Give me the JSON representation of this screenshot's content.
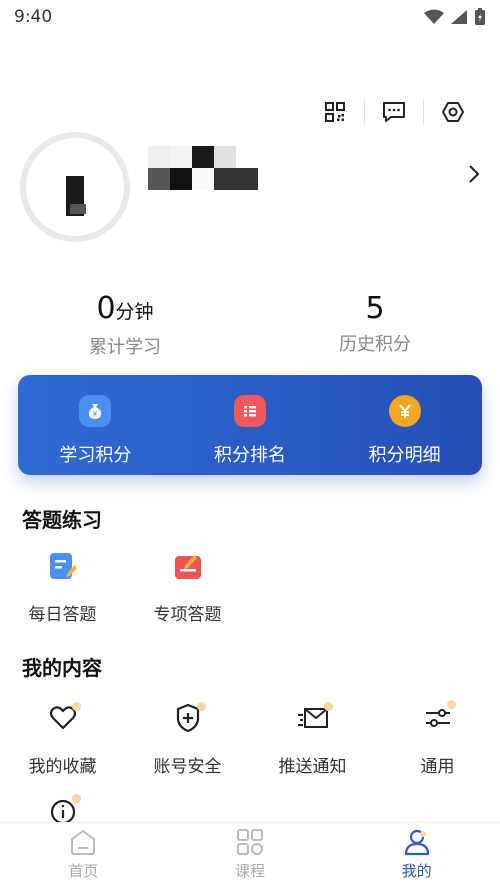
{
  "status_bar": {
    "time": "9:40"
  },
  "top_actions": [
    "qr-code-icon",
    "message-icon",
    "settings-icon"
  ],
  "stats": {
    "study": {
      "value": "0",
      "unit": "分钟",
      "label": "累计学习"
    },
    "points": {
      "value": "5",
      "label": "历史积分"
    }
  },
  "points_card": {
    "items": [
      {
        "label": "学习积分",
        "icon": "money-bag-icon",
        "color": "#4a90f2"
      },
      {
        "label": "积分排名",
        "icon": "ranking-list-icon",
        "color": "#ee5a5a"
      },
      {
        "label": "积分明细",
        "icon": "yuan-coin-icon",
        "color": "#f5a623"
      }
    ]
  },
  "practice": {
    "title": "答题练习",
    "items": [
      {
        "label": "每日答题",
        "icon": "daily-quiz-icon"
      },
      {
        "label": "专项答题",
        "icon": "special-quiz-icon"
      }
    ]
  },
  "my_content": {
    "title": "我的内容",
    "items": [
      {
        "label": "我的收藏",
        "icon": "heart-icon"
      },
      {
        "label": "账号安全",
        "icon": "shield-plus-icon"
      },
      {
        "label": "推送通知",
        "icon": "envelope-icon"
      },
      {
        "label": "通用",
        "icon": "sliders-icon"
      }
    ],
    "extra_icon": "info-icon"
  },
  "tab_bar": {
    "tabs": [
      {
        "label": "首页",
        "icon": "home-icon",
        "active": false
      },
      {
        "label": "课程",
        "icon": "courses-icon",
        "active": false
      },
      {
        "label": "我的",
        "icon": "profile-icon",
        "active": true
      }
    ]
  },
  "colors": {
    "accent": "#2a5bc6",
    "dot": "#f6d7a6"
  }
}
